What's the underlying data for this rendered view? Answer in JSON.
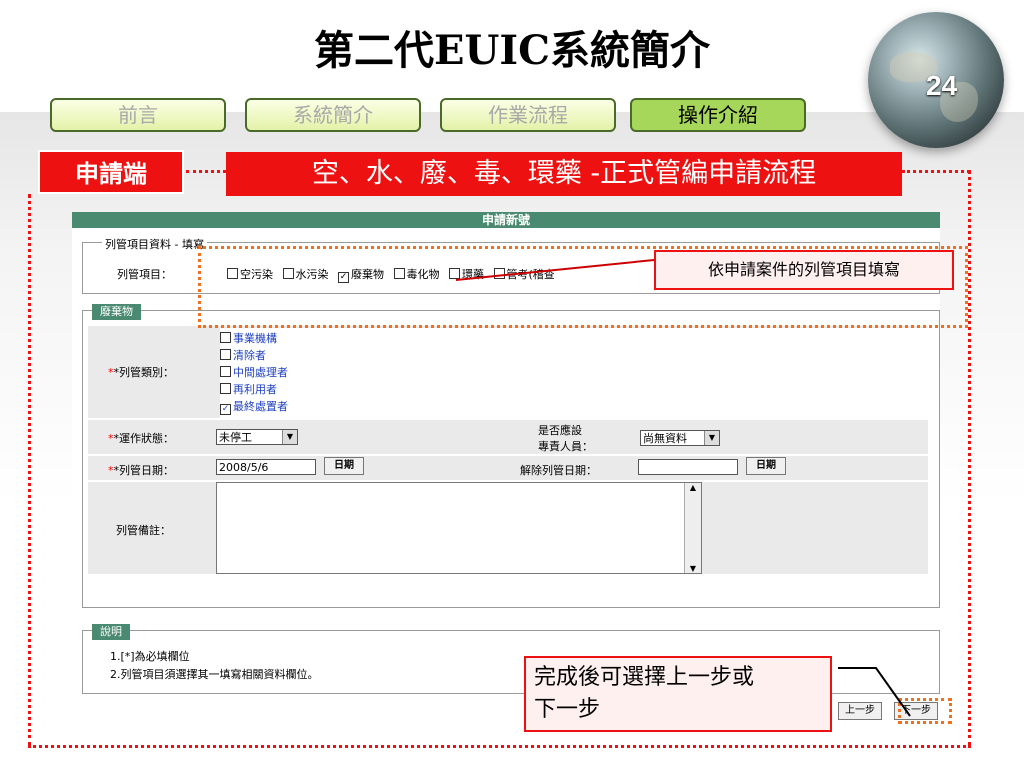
{
  "slide": {
    "title": "第二代EUIC系統簡介",
    "page_number": "24",
    "nav": [
      "前言",
      "系統簡介",
      "作業流程",
      "操作介紹"
    ],
    "side_tag": "申請端",
    "headline": "空、水、廢、毒、環藥 -正式管編申請流程"
  },
  "form": {
    "header": "申請新號",
    "section1": {
      "legend": "列管項目資料 - 填寫",
      "label": "列管項目：",
      "items": [
        {
          "label": "空污染",
          "checked": false
        },
        {
          "label": "水污染",
          "checked": false
        },
        {
          "label": "廢棄物",
          "checked": true
        },
        {
          "label": "毒化物",
          "checked": false
        },
        {
          "label": "環藥",
          "checked": false
        },
        {
          "label": "管考(稽查",
          "checked": false
        }
      ]
    },
    "section2": {
      "legend": "廢棄物",
      "category_label": "*列管類別：",
      "categories": [
        {
          "label": "事業機構",
          "checked": false
        },
        {
          "label": "清除者",
          "checked": false
        },
        {
          "label": "中間處理者",
          "checked": false
        },
        {
          "label": "再利用者",
          "checked": false
        },
        {
          "label": "最終處置者",
          "checked": true
        }
      ],
      "status_label": "*運作狀態：",
      "status_value": "未停工",
      "staff_label_1": "是否應設",
      "staff_label_2": "專責人員：",
      "staff_value": "尚無資料",
      "date_label": "*列管日期：",
      "date_value": "2008/5/6",
      "date_button": "日期",
      "end_date_label": "解除列管日期：",
      "end_date_value": "",
      "end_date_button": "日期",
      "remark_label": "列管備註："
    },
    "notes": {
      "legend": "說明",
      "line1": "1.[*]為必填欄位",
      "line2": "2.列管項目須選擇其一填寫相關資料欄位。"
    },
    "buttons": {
      "prev": "上一步",
      "next": "下一步"
    }
  },
  "annotations": {
    "callout1": "依申請案件的列管項目填寫",
    "callout2_line1": "完成後可選擇上一步或",
    "callout2_line2": "下一步"
  },
  "colors": {
    "red": "#ee1111",
    "form_green": "#4a8a70",
    "nav_green": "#a6d65a",
    "orange": "#f07020"
  }
}
